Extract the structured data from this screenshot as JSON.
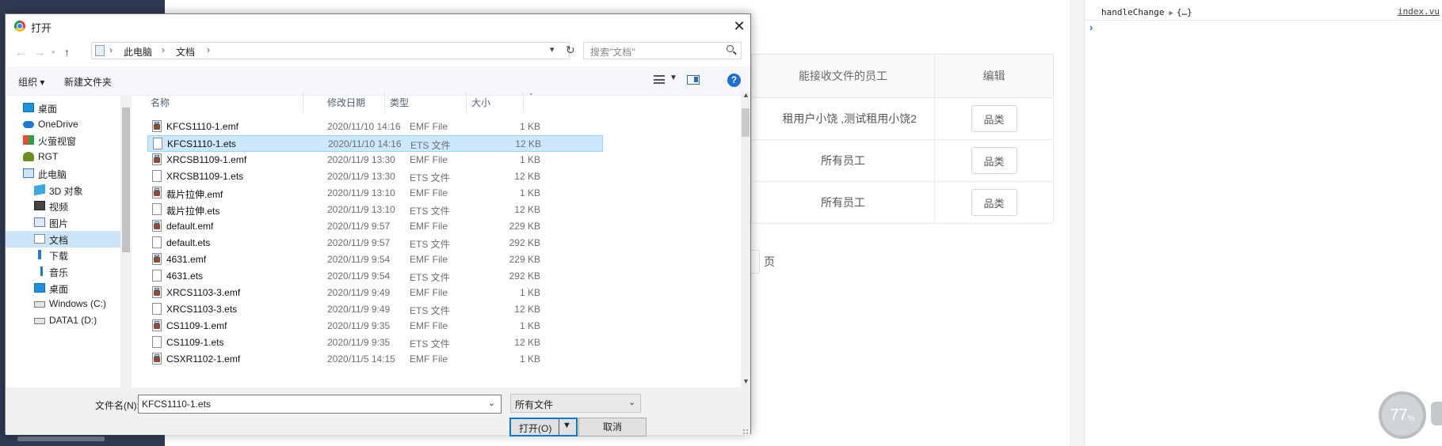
{
  "dialog": {
    "title": "打开",
    "close_glyph": "✕",
    "breadcrumb": [
      "此电脑",
      "文档"
    ],
    "breadcrumb_sep": "›",
    "search_placeholder": "搜索\"文档\"",
    "toolbar": {
      "organize": "组织 ▾",
      "new_folder": "新建文件夹",
      "help": "?"
    },
    "tree": [
      {
        "label": "桌面",
        "icon": "desktop-icon"
      },
      {
        "label": "OneDrive",
        "icon": "cloud-icon"
      },
      {
        "label": "火萤视窗",
        "icon": "app-grid-icon"
      },
      {
        "label": "RGT",
        "icon": "user-icon"
      },
      {
        "label": "此电脑",
        "icon": "computer-icon"
      },
      {
        "label": "3D 对象",
        "icon": "cube-icon"
      },
      {
        "label": "视频",
        "icon": "video-icon"
      },
      {
        "label": "图片",
        "icon": "picture-icon"
      },
      {
        "label": "文档",
        "icon": "document-icon",
        "selected": true
      },
      {
        "label": "下载",
        "icon": "download-icon"
      },
      {
        "label": "音乐",
        "icon": "music-icon"
      },
      {
        "label": "桌面",
        "icon": "desktop-icon"
      },
      {
        "label": "Windows (C:)",
        "icon": "drive-icon"
      },
      {
        "label": "DATA1 (D:)",
        "icon": "drive-icon"
      }
    ],
    "columns": {
      "name": "名称",
      "date": "修改日期",
      "type": "类型",
      "size": "大小"
    },
    "files": [
      {
        "name": "KFCS1110-1.emf",
        "date": "2020/11/10 14:16",
        "type": "EMF File",
        "size": "1 KB",
        "kind": "emf"
      },
      {
        "name": "KFCS1110-1.ets",
        "date": "2020/11/10 14:16",
        "type": "ETS 文件",
        "size": "12 KB",
        "kind": "ets",
        "selected": true
      },
      {
        "name": "XRCSB1109-1.emf",
        "date": "2020/11/9 13:30",
        "type": "EMF File",
        "size": "1 KB",
        "kind": "emf"
      },
      {
        "name": "XRCSB1109-1.ets",
        "date": "2020/11/9 13:30",
        "type": "ETS 文件",
        "size": "12 KB",
        "kind": "ets"
      },
      {
        "name": "裁片拉伸.emf",
        "date": "2020/11/9 13:10",
        "type": "EMF File",
        "size": "1 KB",
        "kind": "emf"
      },
      {
        "name": "裁片拉伸.ets",
        "date": "2020/11/9 13:10",
        "type": "ETS 文件",
        "size": "12 KB",
        "kind": "ets"
      },
      {
        "name": "default.emf",
        "date": "2020/11/9 9:57",
        "type": "EMF File",
        "size": "229 KB",
        "kind": "emf"
      },
      {
        "name": "default.ets",
        "date": "2020/11/9 9:57",
        "type": "ETS 文件",
        "size": "292 KB",
        "kind": "ets"
      },
      {
        "name": "4631.emf",
        "date": "2020/11/9 9:54",
        "type": "EMF File",
        "size": "229 KB",
        "kind": "emf"
      },
      {
        "name": "4631.ets",
        "date": "2020/11/9 9:54",
        "type": "ETS 文件",
        "size": "292 KB",
        "kind": "ets"
      },
      {
        "name": "XRCS1103-3.emf",
        "date": "2020/11/9 9:49",
        "type": "EMF File",
        "size": "1 KB",
        "kind": "emf"
      },
      {
        "name": "XRCS1103-3.ets",
        "date": "2020/11/9 9:49",
        "type": "ETS 文件",
        "size": "12 KB",
        "kind": "ets"
      },
      {
        "name": "CS1109-1.emf",
        "date": "2020/11/9 9:35",
        "type": "EMF File",
        "size": "1 KB",
        "kind": "emf"
      },
      {
        "name": "CS1109-1.ets",
        "date": "2020/11/9 9:35",
        "type": "ETS 文件",
        "size": "12 KB",
        "kind": "ets"
      },
      {
        "name": "CSXR1102-1.emf",
        "date": "2020/11/5 14:15",
        "type": "EMF File",
        "size": "1 KB",
        "kind": "emf"
      }
    ],
    "filename_label": "文件名(N):",
    "filename_value": "KFCS1110-1.ets",
    "filetype_value": "所有文件",
    "open_label": "打开(O)",
    "cancel_label": "取消"
  },
  "background_page": {
    "col_employees": "能接收文件的员工",
    "col_edit": "编辑",
    "rows": [
      {
        "employees": "租用户小饶 ,测试租用小饶2",
        "button": "品类"
      },
      {
        "employees": "所有员工",
        "button": "品类"
      },
      {
        "employees": "所有员工",
        "button": "品类"
      }
    ],
    "pager_suffix": "页"
  },
  "devtools": {
    "log_fn": "handleChange",
    "log_obj": "{…}",
    "source_link": "index.vu",
    "prompt": "›",
    "zoom_percent": 77
  },
  "colors": {
    "selection": "#cce8ff",
    "accent": "#0078d7",
    "nav_strip": "#2f3b52"
  }
}
